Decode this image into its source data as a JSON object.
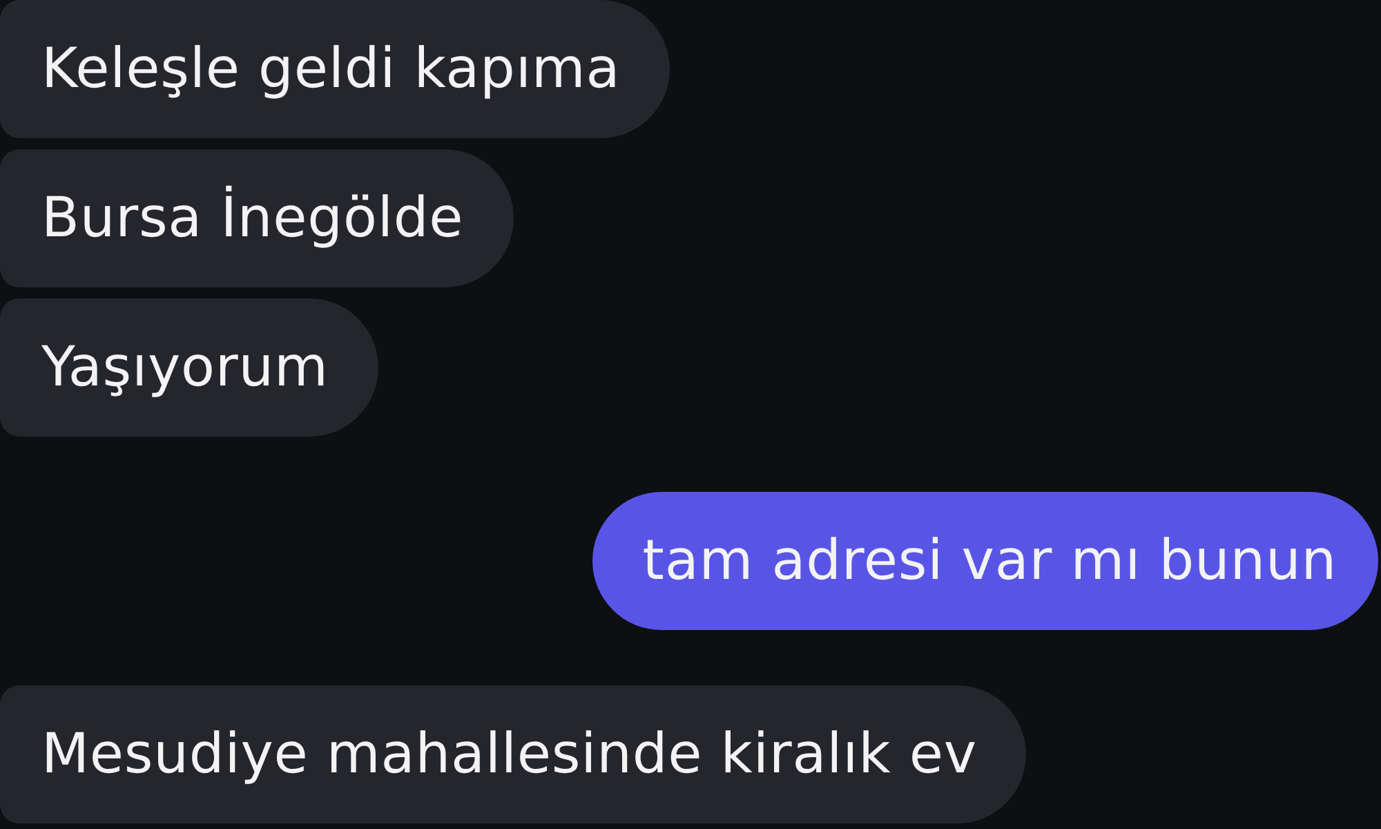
{
  "messages": [
    {
      "kind": "incoming",
      "text": "Keleşle geldi kapıma"
    },
    {
      "kind": "incoming",
      "text": "Bursa İnegölde"
    },
    {
      "kind": "incoming",
      "text": "Yaşıyorum"
    },
    {
      "kind": "outgoing",
      "text": "tam adresi var mı bunun"
    },
    {
      "kind": "incoming",
      "text": "Mesudiye mahallesinde kiralık ev"
    }
  ]
}
